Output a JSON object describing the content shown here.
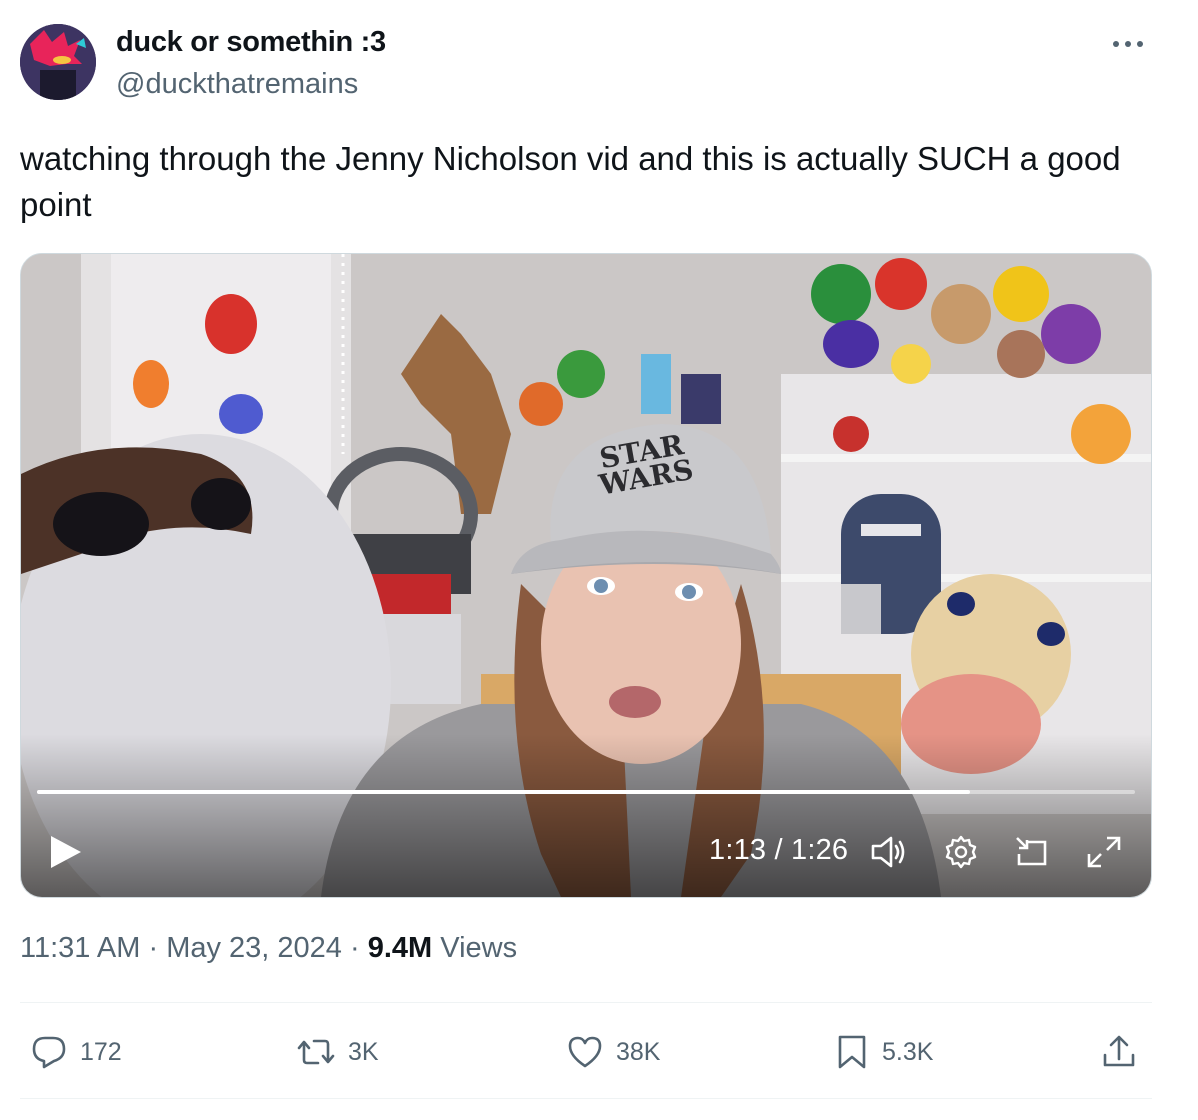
{
  "tweet": {
    "display_name": "duck or somethin :3",
    "handle": "@duckthatremains",
    "text": "watching through the Jenny Nicholson vid and this is actually SUCH a good point",
    "time": "11:31 AM",
    "date": "May 23, 2024",
    "separator": "·",
    "views_count": "9.4M",
    "views_label": "Views"
  },
  "video": {
    "current_time": "1:13",
    "duration": "1:26",
    "time_display": "1:13 / 1:26",
    "progress": 0.85,
    "cap_text_line1": "STAR",
    "cap_text_line2": "WARS"
  },
  "actions": {
    "replies": "172",
    "reposts": "3K",
    "likes": "38K",
    "bookmarks": "5.3K"
  },
  "icons": [
    "more-icon",
    "play-icon",
    "volume-icon",
    "settings-icon",
    "pip-icon",
    "fullscreen-icon",
    "reply-icon",
    "repost-icon",
    "like-icon",
    "bookmark-icon",
    "share-icon"
  ]
}
